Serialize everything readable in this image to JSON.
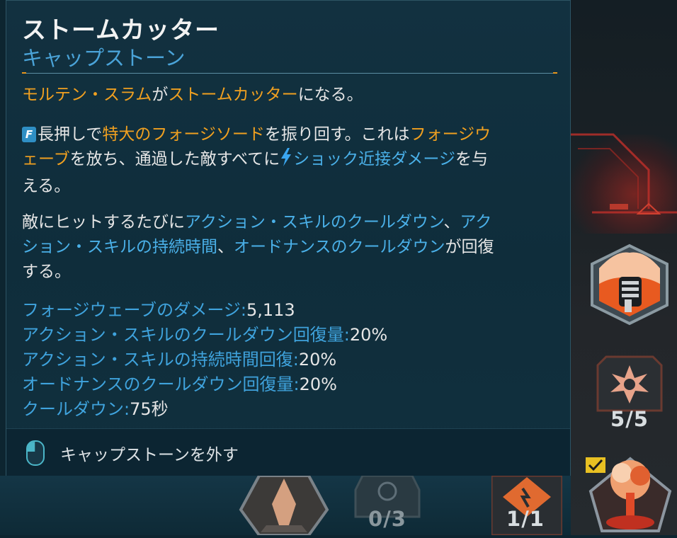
{
  "tooltip": {
    "title": "ストームカッター",
    "subtitle": "キャップストーン",
    "line1": {
      "a": "モルテン・スラム",
      "b": "が",
      "c": "ストームカッター",
      "d": "になる。"
    },
    "para2": {
      "key": "F",
      "t1": "長押しで",
      "h1": "特大のフォージソード",
      "t2": "を振り回す。これは",
      "h2a": "フォージウ",
      "h2b": "ェーブ",
      "t3": "を放ち、通過した敵すべてに",
      "h3": "ショック近接ダメージ",
      "t4a": "を与",
      "t4b": "える。"
    },
    "para3": {
      "t1": "敵にヒットするたびに",
      "h1": "アクション・スキルのクールダウン",
      "t2": "、",
      "h2a": "アク",
      "h2b": "ション・スキルの持続時間",
      "t3": "、",
      "h3": "オードナンスのクールダウン",
      "t4a": "が回復",
      "t4b": "する。"
    },
    "stats": [
      {
        "label": "フォージウェーブのダメージ:",
        "value": "5,113"
      },
      {
        "label": "アクション・スキルのクールダウン回復量:",
        "value": "20%"
      },
      {
        "label": "アクション・スキルの持続時間回復:",
        "value": "20%"
      },
      {
        "label": "オードナンスのクールダウン回復量:",
        "value": "20%"
      },
      {
        "label": "クールダウン:",
        "value": "75秒"
      }
    ],
    "footer_action": "キャップストーンを外す"
  },
  "skill_slots": {
    "right_mid_count": "5/5",
    "right_bottom_count": "1/1",
    "bottom_mid_count": "0/3"
  },
  "colors": {
    "highlight_orange": "#f0a020",
    "highlight_blue": "#4ab0e8",
    "title_white": "#f2f2f2",
    "subtitle_blue": "#4aa3d8"
  },
  "icons": [
    "f-key-icon",
    "lightning-bolt-icon",
    "mouse-left-click-icon",
    "fist-skill-icon",
    "burst-skill-icon",
    "explosion-skill-icon",
    "flame-skill-icon",
    "checkmark-icon"
  ]
}
